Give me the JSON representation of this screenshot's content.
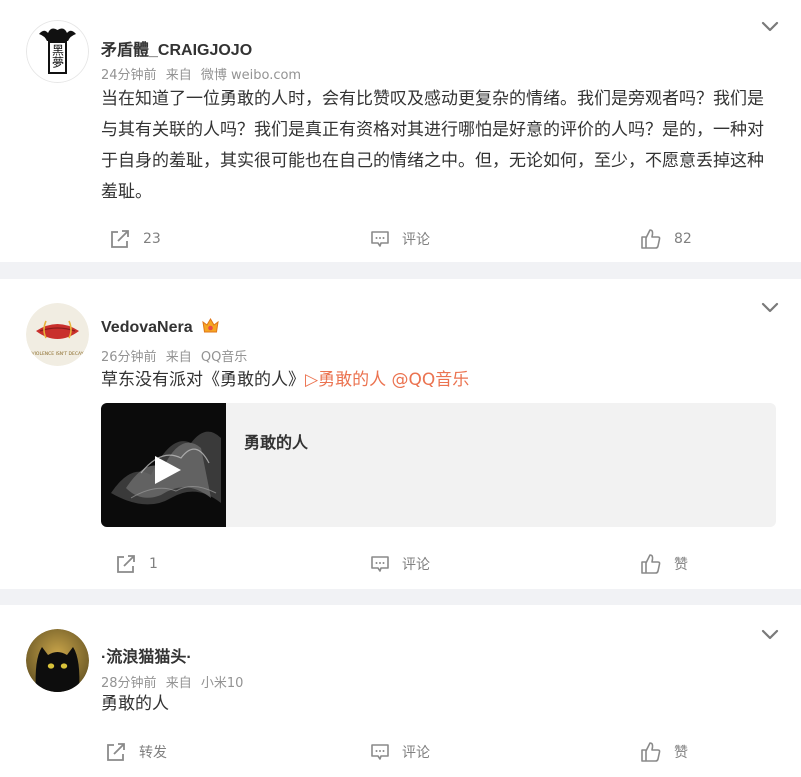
{
  "posts": [
    {
      "username": "矛盾體_CRAIGJOJO",
      "time": "24分钟前",
      "source_prefix": "来自",
      "source": "微博 weibo.com",
      "text": "当在知道了一位勇敢的人时，会有比赞叹及感动更复杂的情绪。我们是旁观者吗？我们是与其有关联的人吗？我们是真正有资格对其进行哪怕是好意的评价的人吗？是的，一种对于自身的羞耻，其实很可能也在自己的情绪之中。但，无论如何，至少，不愿意丢掉这种羞耻。",
      "avatar_text": "黑夢",
      "actions": {
        "repost": "23",
        "comment": "评论",
        "like": "82"
      }
    },
    {
      "username": "VedovaNera",
      "badge_icon": "vip-crown-icon",
      "time": "26分钟前",
      "source_prefix": "来自",
      "source": "QQ音乐",
      "text_plain": "草东没有派对《勇敢的人》",
      "text_link_song": "▷勇敢的人",
      "text_link_at": "@QQ音乐",
      "music_title": "勇敢的人",
      "actions": {
        "repost": "1",
        "comment": "评论",
        "like": "赞"
      }
    },
    {
      "username": "·流浪猫猫头·",
      "time": "28分钟前",
      "source_prefix": "来自",
      "source": "小米10",
      "text": "勇敢的人",
      "actions": {
        "repost": "转发",
        "comment": "评论",
        "like": "赞"
      }
    }
  ],
  "colors": {
    "background": "#f1f2f5",
    "card": "#ffffff",
    "link": "#eb7350",
    "meta": "#939393",
    "action": "#808080"
  }
}
